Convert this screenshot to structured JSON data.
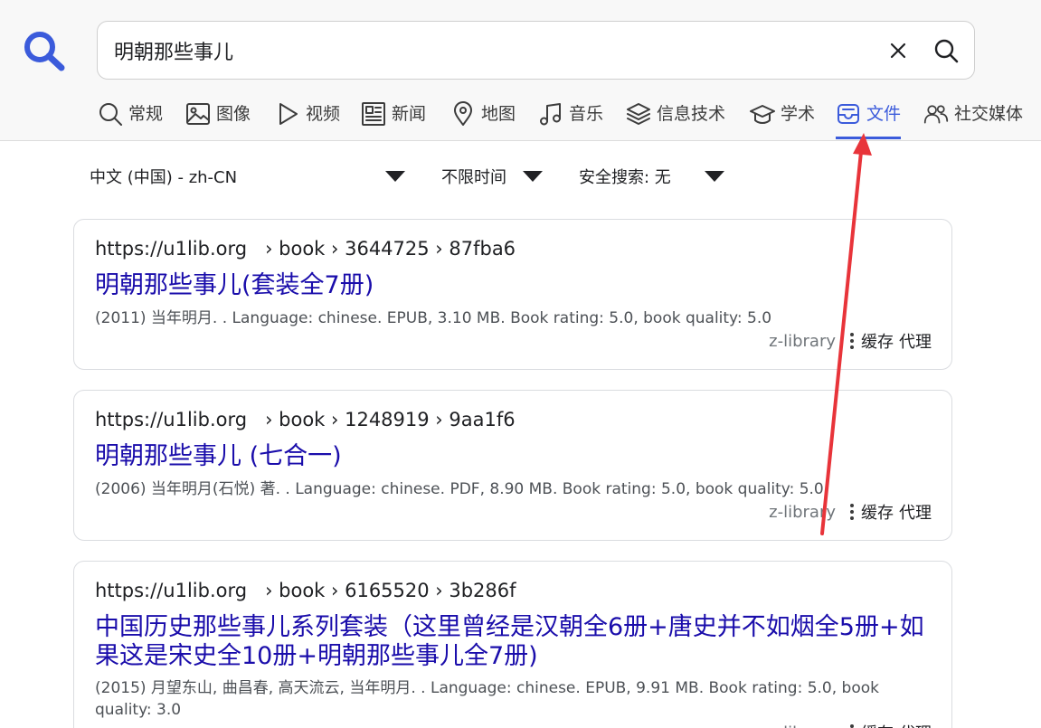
{
  "search": {
    "query": "明朝那些事儿"
  },
  "tabs": [
    {
      "label": "常规",
      "icon": "search-icon"
    },
    {
      "label": "图像",
      "icon": "image-icon"
    },
    {
      "label": "视频",
      "icon": "play-icon"
    },
    {
      "label": "新闻",
      "icon": "newspaper-icon"
    },
    {
      "label": "地图",
      "icon": "map-pin-icon"
    },
    {
      "label": "音乐",
      "icon": "music-note-icon"
    },
    {
      "label": "信息技术",
      "icon": "layers-icon"
    },
    {
      "label": "学术",
      "icon": "graduation-cap-icon"
    },
    {
      "label": "文件",
      "icon": "inbox-icon",
      "active": true
    },
    {
      "label": "社交媒体",
      "icon": "people-icon"
    }
  ],
  "filters": {
    "language": "中文 (中国) - zh-CN",
    "time": "不限时间",
    "safesearch": "安全搜索: 无"
  },
  "results": [
    {
      "url": "https://u1lib.org   › book › 3644725 › 87fba6",
      "title": "明朝那些事儿(套装全7册)",
      "snippet": "(2011) 当年明月. . Language: chinese. EPUB, 3.10 MB. Book rating: 5.0, book quality: 5.0",
      "engine": "z-library",
      "cache": "缓存",
      "proxy": "代理"
    },
    {
      "url": "https://u1lib.org   › book › 1248919 › 9aa1f6",
      "title": "明朝那些事儿 (七合一)",
      "snippet": "(2006) 当年明月(石悦) 著. . Language: chinese. PDF, 8.90 MB. Book rating: 5.0, book quality: 5.0",
      "engine": "z-library",
      "cache": "缓存",
      "proxy": "代理"
    },
    {
      "url": "https://u1lib.org   › book › 6165520 › 3b286f",
      "title": "中国历史那些事儿系列套装（这里曾经是汉朝全6册+唐史并不如烟全5册+如果这是宋史全10册+明朝那些事儿全7册)",
      "snippet": "(2015) 月望东山, 曲昌春, 高天流云, 当年明月. . Language: chinese. EPUB, 9.91 MB. Book rating: 5.0, book quality: 3.0",
      "engine": "z-library",
      "cache": "缓存",
      "proxy": "代理"
    }
  ],
  "colors": {
    "accent": "#3b5bdb",
    "link": "#1a0dab",
    "annotation_arrow": "#e8343a"
  }
}
